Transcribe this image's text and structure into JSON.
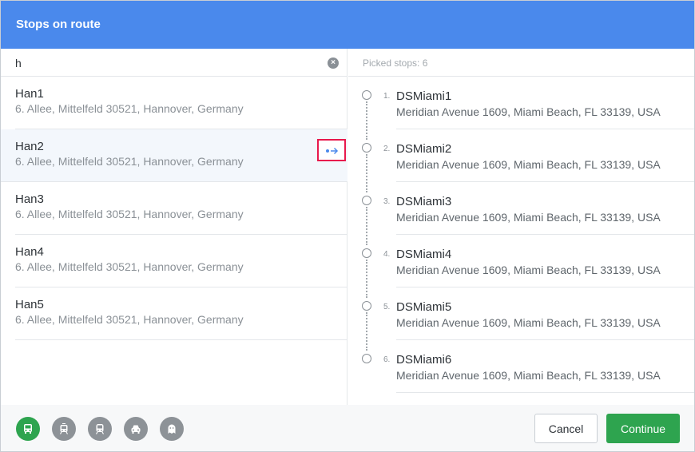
{
  "header": {
    "title": "Stops on route"
  },
  "search": {
    "value": "h",
    "clear_icon": "clear-icon"
  },
  "results": [
    {
      "name": "Han1",
      "address": "6. Allee, Mittelfeld 30521, Hannover, Germany"
    },
    {
      "name": "Han2",
      "address": "6. Allee, Mittelfeld 30521, Hannover, Germany"
    },
    {
      "name": "Han3",
      "address": "6. Allee, Mittelfeld 30521, Hannover, Germany"
    },
    {
      "name": "Han4",
      "address": "6. Allee, Mittelfeld 30521, Hannover, Germany"
    },
    {
      "name": "Han5",
      "address": "6. Allee, Mittelfeld 30521, Hannover, Germany"
    }
  ],
  "picked": {
    "label": "Picked stops: 6",
    "stops": [
      {
        "num": "1.",
        "name": "DSMiami1",
        "address": "Meridian Avenue 1609, Miami Beach, FL 33139, USA"
      },
      {
        "num": "2.",
        "name": "DSMiami2",
        "address": "Meridian Avenue 1609, Miami Beach, FL 33139, USA"
      },
      {
        "num": "3.",
        "name": "DSMiami3",
        "address": "Meridian Avenue 1609, Miami Beach, FL 33139, USA"
      },
      {
        "num": "4.",
        "name": "DSMiami4",
        "address": "Meridian Avenue 1609, Miami Beach, FL 33139, USA"
      },
      {
        "num": "5.",
        "name": "DSMiami5",
        "address": "Meridian Avenue 1609, Miami Beach, FL 33139, USA"
      },
      {
        "num": "6.",
        "name": "DSMiami6",
        "address": "Meridian Avenue 1609, Miami Beach, FL 33139, USA"
      }
    ]
  },
  "vehicles": [
    {
      "icon": "bus-icon",
      "active": true
    },
    {
      "icon": "tram-icon",
      "active": false
    },
    {
      "icon": "train-icon",
      "active": false
    },
    {
      "icon": "car-icon",
      "active": false
    },
    {
      "icon": "ghost-icon",
      "active": false
    }
  ],
  "footer": {
    "cancel_label": "Cancel",
    "continue_label": "Continue"
  },
  "colors": {
    "header": "#4a89ec",
    "accent_green": "#2ea44f",
    "highlight_border": "#e8194d",
    "arrow_blue": "#4a89ec"
  }
}
